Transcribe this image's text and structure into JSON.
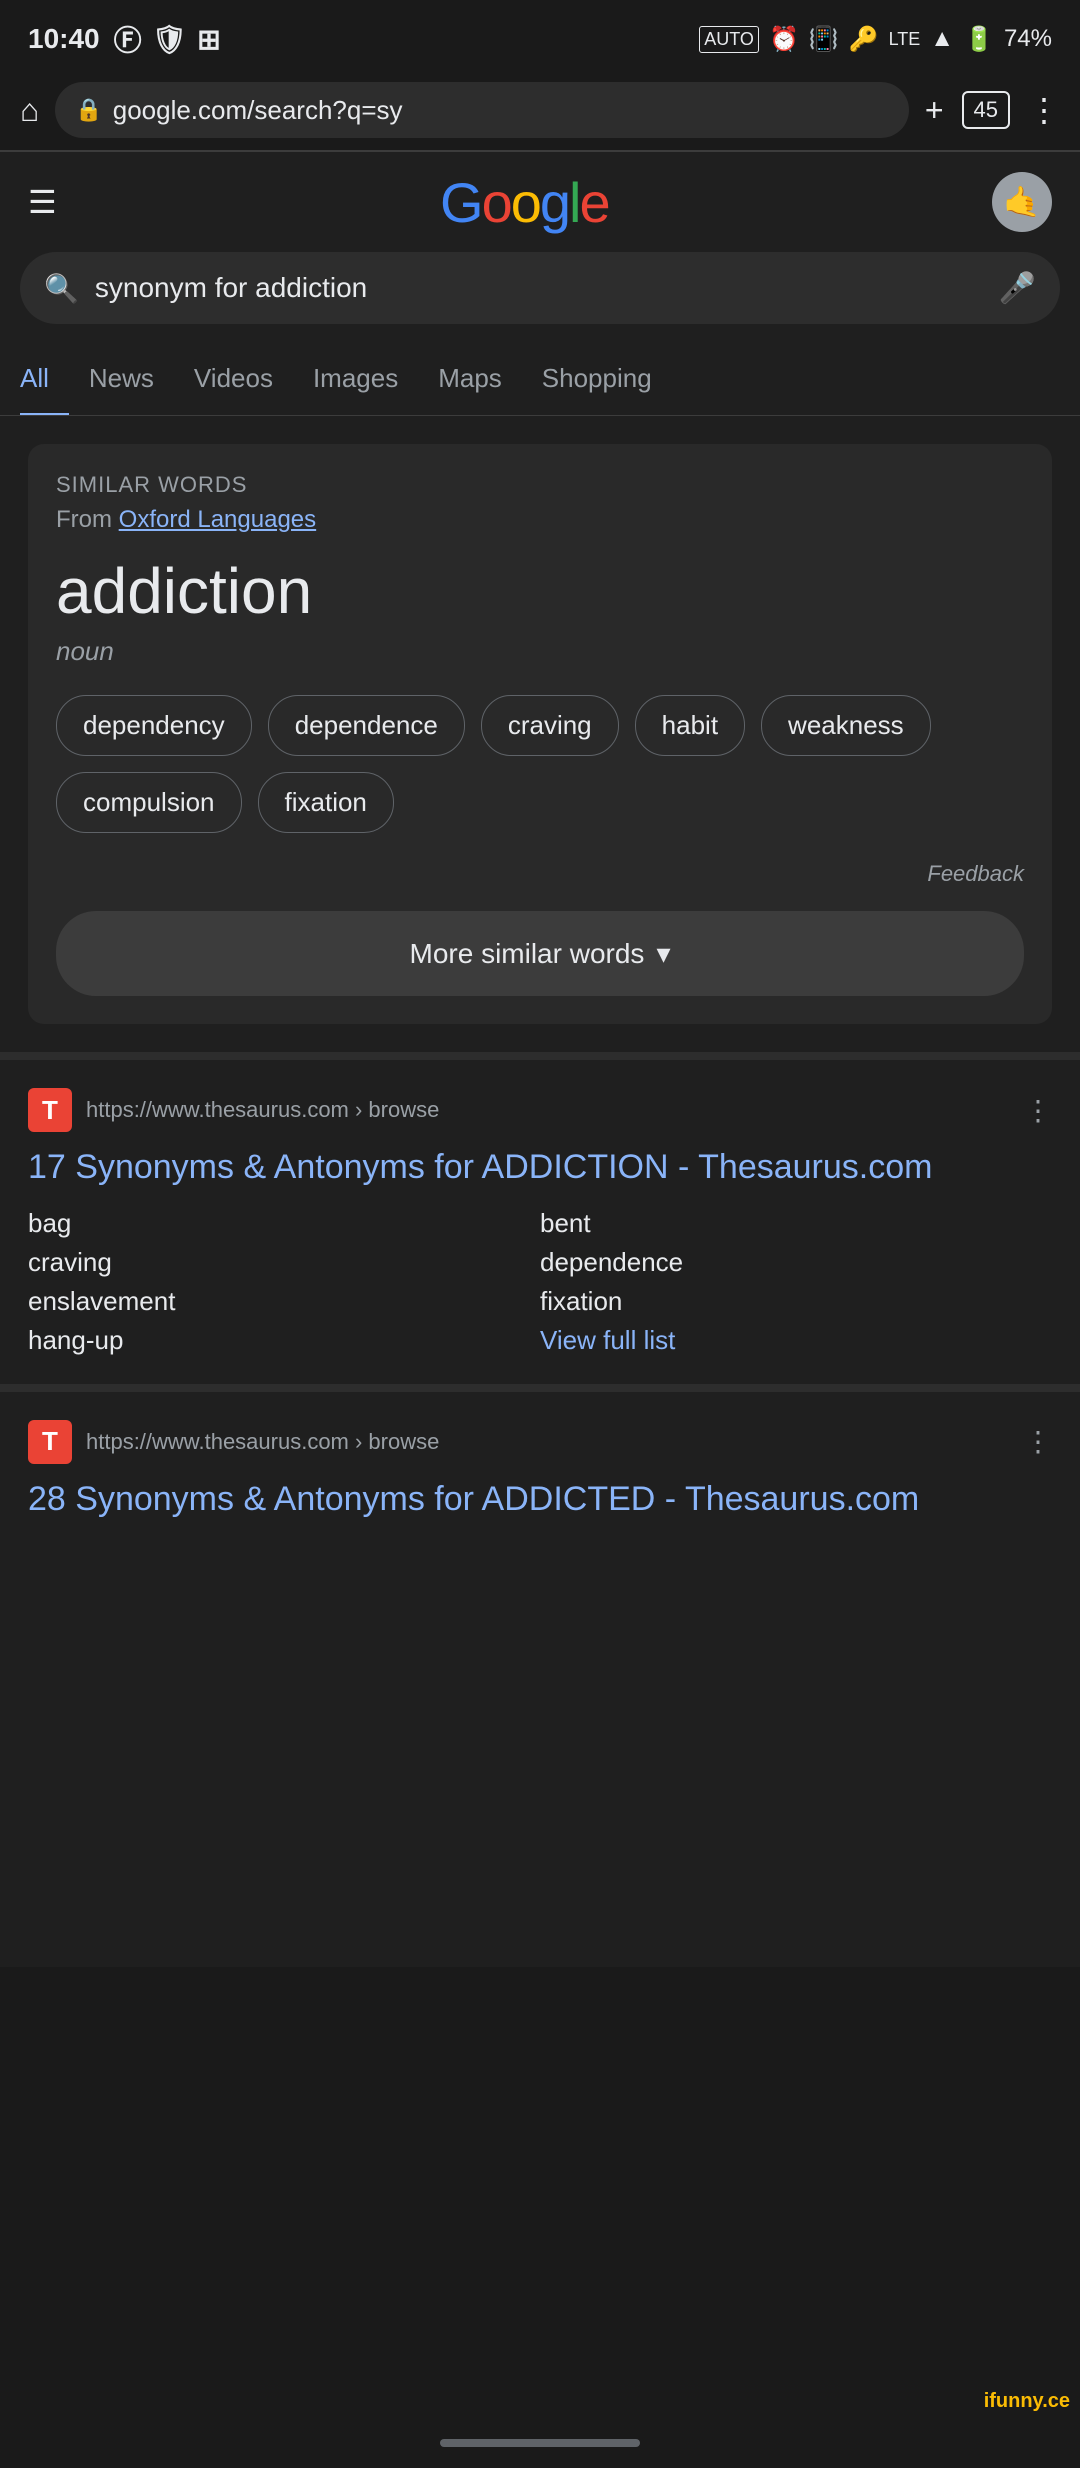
{
  "statusBar": {
    "time": "10:40",
    "battery": "74%",
    "signal": "4G+"
  },
  "browser": {
    "url": "google.com/search?q=sy",
    "tabCount": "45"
  },
  "googleHeader": {
    "logoText": "Google",
    "logoLetters": [
      "G",
      "o",
      "o",
      "g",
      "l",
      "e"
    ]
  },
  "search": {
    "query": "synonym for addiction",
    "placeholder": "synonym for addiction"
  },
  "tabs": [
    {
      "label": "All",
      "active": true
    },
    {
      "label": "News",
      "active": false
    },
    {
      "label": "Videos",
      "active": false
    },
    {
      "label": "Images",
      "active": false
    },
    {
      "label": "Maps",
      "active": false
    },
    {
      "label": "Shopping",
      "active": false
    }
  ],
  "similarWords": {
    "sectionLabel": "SIMILAR WORDS",
    "sourcePrefix": "From",
    "sourceName": "Oxford Languages",
    "word": "addiction",
    "partOfSpeech": "noun",
    "synonyms": [
      "dependency",
      "dependence",
      "craving",
      "habit",
      "weakness",
      "compulsion",
      "fixation"
    ],
    "feedbackLabel": "Feedback",
    "moreButtonLabel": "More similar words"
  },
  "results": [
    {
      "favicon": "T",
      "faviconColor": "#ea4335",
      "url": "https://www.thesaurus.com › browse",
      "title": "17 Synonyms & Antonyms for ADDICTION - Thesaurus.com",
      "previewWords": [
        {
          "text": "bag",
          "muted": false
        },
        {
          "text": "bent",
          "muted": false
        },
        {
          "text": "craving",
          "muted": false
        },
        {
          "text": "dependence",
          "muted": false
        },
        {
          "text": "enslavement",
          "muted": false
        },
        {
          "text": "fixation",
          "muted": false
        },
        {
          "text": "hang-up",
          "muted": false
        },
        {
          "text": "View full list",
          "muted": false,
          "isLink": true
        }
      ]
    },
    {
      "favicon": "T",
      "faviconColor": "#ea4335",
      "url": "https://www.thesaurus.com › browse",
      "title": "28 Synonyms & Antonyms for ADDICTED - Thesaurus.com",
      "previewWords": []
    }
  ],
  "watermark": "ifunny.ce"
}
